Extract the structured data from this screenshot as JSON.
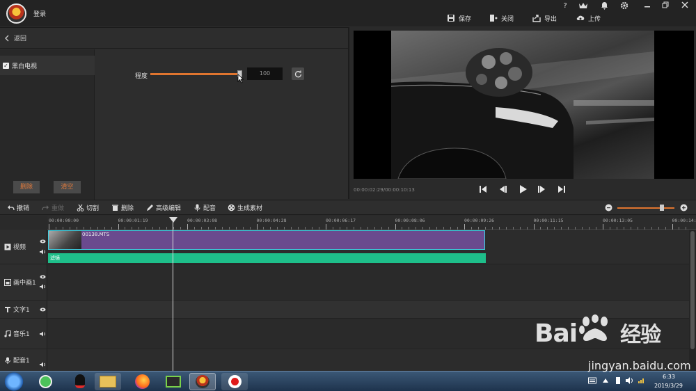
{
  "titlebar": {
    "login": "登录",
    "buttons": [
      {
        "label": "保存",
        "icon": "save-icon"
      },
      {
        "label": "关闭",
        "icon": "close-doc-icon"
      },
      {
        "label": "导出",
        "icon": "export-icon"
      },
      {
        "label": "上传",
        "icon": "upload-icon"
      }
    ],
    "help": "?",
    "vip": "VIP"
  },
  "left": {
    "back": "返回",
    "effect": "黑白电视",
    "effect_checked": true,
    "delete": "删除",
    "clear": "清空",
    "degree_label": "程度",
    "degree_value": "100",
    "degree_fraction": 1.0
  },
  "preview": {
    "timecode": "00:00:02:29/00:00:10:13"
  },
  "toolbar": {
    "undo": "撤销",
    "redo": "重做",
    "cut": "切割",
    "delete": "删除",
    "advanced": "高级编辑",
    "dub": "配音",
    "generate": "生成素材",
    "zoom_fraction": 0.78
  },
  "timeline": {
    "ticks": [
      "00:00:00:00",
      "00:00:01:19",
      "00:00:03:08",
      "00:00:04:28",
      "00:00:06:17",
      "00:00:08:06",
      "00:00:09:26",
      "00:00:11:15",
      "00:00:13:05",
      "00:00:14:"
    ],
    "tracks": [
      "视频",
      "画中画1",
      "文字1",
      "音乐1",
      "配音1"
    ],
    "clip_name": "00138.MTS",
    "effect_bar": "滤镜"
  },
  "taskbar": {
    "time": "6:33",
    "date": "2019/3/29"
  },
  "watermark": {
    "logo": "Bai",
    "logo2": "经验",
    "url": "jingyan.baidu.com"
  }
}
